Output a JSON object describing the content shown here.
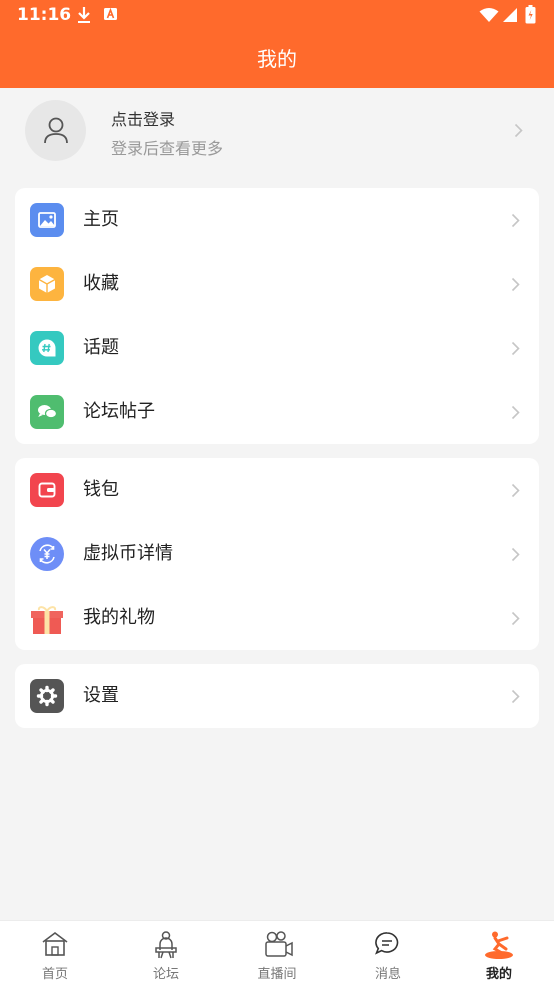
{
  "status_bar": {
    "time": "11:16"
  },
  "header": {
    "title": "我的"
  },
  "login": {
    "title": "点击登录",
    "subtitle": "登录后查看更多"
  },
  "menu_group_1": [
    {
      "label": "主页",
      "icon": "image-icon",
      "color": "#5b8def"
    },
    {
      "label": "收藏",
      "icon": "box-icon",
      "color": "#fdb43f"
    },
    {
      "label": "话题",
      "icon": "hashtag-chat-icon",
      "color": "#35c9c0"
    },
    {
      "label": "论坛帖子",
      "icon": "chat-bubbles-icon",
      "color": "#4fbd6f"
    }
  ],
  "menu_group_2": [
    {
      "label": "钱包",
      "icon": "wallet-icon",
      "color": "#f2454e"
    },
    {
      "label": "虚拟币详情",
      "icon": "yuan-coin-icon",
      "color": "#6e8ef7"
    },
    {
      "label": "我的礼物",
      "icon": "gift-icon",
      "color": "#f0645e"
    }
  ],
  "menu_group_3": [
    {
      "label": "设置",
      "icon": "gear-icon",
      "color": "#555555"
    }
  ],
  "tabbar": [
    {
      "label": "首页",
      "icon": "home-icon"
    },
    {
      "label": "论坛",
      "icon": "forum-icon"
    },
    {
      "label": "直播间",
      "icon": "camera-icon"
    },
    {
      "label": "消息",
      "icon": "message-icon"
    },
    {
      "label": "我的",
      "icon": "profile-icon",
      "active": true
    }
  ],
  "colors": {
    "brand": "#ff6a2c",
    "background": "#f4f4f4"
  }
}
